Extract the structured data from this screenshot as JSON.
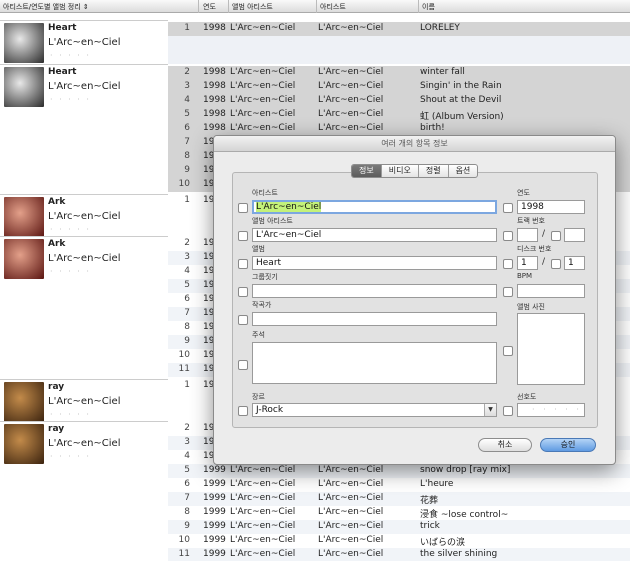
{
  "header": {
    "sort_col": "아티스트/연도별 앨범 정리",
    "year": "연도",
    "album_artist": "앨범 아티스트",
    "artist": "아티스트",
    "name": "이름"
  },
  "groups": [
    {
      "album": "Heart",
      "artist": "L'Arc~en~Ciel",
      "rating": "· · · · ·",
      "colors": [
        "#e8e8e8",
        "#2a2a2a"
      ]
    },
    {
      "album": "Heart",
      "artist": "L'Arc~en~Ciel",
      "rating": "· · · · ·",
      "colors": [
        "#e8e8e8",
        "#2a2a2a"
      ]
    },
    {
      "album": "Ark",
      "artist": "L'Arc~en~Ciel",
      "rating": "· · · · ·",
      "colors": [
        "#e3a08a",
        "#5a1410"
      ]
    },
    {
      "album": "Ark",
      "artist": "L'Arc~en~Ciel",
      "rating": "· · · · ·",
      "colors": [
        "#e3a08a",
        "#5a1410"
      ]
    },
    {
      "album": "ray",
      "artist": "L'Arc~en~Ciel",
      "rating": "· · · · ·",
      "colors": [
        "#c38b4a",
        "#3a220e"
      ]
    },
    {
      "album": "ray",
      "artist": "L'Arc~en~Ciel",
      "rating": "· · · · ·",
      "colors": [
        "#c38b4a",
        "#3a220e"
      ]
    }
  ],
  "tracks": [
    {
      "num": "1",
      "year": "1998",
      "album_artist": "L'Arc~en~Ciel",
      "artist": "L'Arc~en~Ciel",
      "title": "LORELEY"
    },
    {
      "num": "2",
      "year": "1998",
      "album_artist": "L'Arc~en~Ciel",
      "artist": "L'Arc~en~Ciel",
      "title": "winter fall"
    },
    {
      "num": "3",
      "year": "1998",
      "album_artist": "L'Arc~en~Ciel",
      "artist": "L'Arc~en~Ciel",
      "title": "Singin' in the Rain"
    },
    {
      "num": "4",
      "year": "1998",
      "album_artist": "L'Arc~en~Ciel",
      "artist": "L'Arc~en~Ciel",
      "title": "Shout at the Devil"
    },
    {
      "num": "5",
      "year": "1998",
      "album_artist": "L'Arc~en~Ciel",
      "artist": "L'Arc~en~Ciel",
      "title": "虹 (Album Version)"
    },
    {
      "num": "6",
      "year": "1998",
      "album_artist": "L'Arc~en~Ciel",
      "artist": "L'Arc~en~Ciel",
      "title": "birth!"
    },
    {
      "num": "7",
      "year": "19",
      "album_artist": "",
      "artist": "",
      "title": ""
    },
    {
      "num": "8",
      "year": "19",
      "album_artist": "",
      "artist": "",
      "title": ""
    },
    {
      "num": "9",
      "year": "19",
      "album_artist": "",
      "artist": "",
      "title": ""
    },
    {
      "num": "10",
      "year": "19",
      "album_artist": "",
      "artist": "",
      "title": ""
    },
    {
      "num": "1",
      "year": "19",
      "album_artist": "",
      "artist": "",
      "title": ""
    },
    {
      "num": "2",
      "year": "19",
      "album_artist": "",
      "artist": "",
      "title": ""
    },
    {
      "num": "3",
      "year": "19",
      "album_artist": "",
      "artist": "",
      "title": ""
    },
    {
      "num": "4",
      "year": "19",
      "album_artist": "",
      "artist": "",
      "title": ""
    },
    {
      "num": "5",
      "year": "19",
      "album_artist": "",
      "artist": "",
      "title": ""
    },
    {
      "num": "6",
      "year": "19",
      "album_artist": "",
      "artist": "",
      "title": ""
    },
    {
      "num": "7",
      "year": "19",
      "album_artist": "",
      "artist": "",
      "title": ""
    },
    {
      "num": "8",
      "year": "19",
      "album_artist": "",
      "artist": "",
      "title": ""
    },
    {
      "num": "9",
      "year": "19",
      "album_artist": "",
      "artist": "",
      "title": ""
    },
    {
      "num": "10",
      "year": "19",
      "album_artist": "",
      "artist": "",
      "title": ""
    },
    {
      "num": "11",
      "year": "19",
      "album_artist": "",
      "artist": "",
      "title": ""
    },
    {
      "num": "1",
      "year": "19",
      "album_artist": "",
      "artist": "",
      "title": ""
    },
    {
      "num": "2",
      "year": "19",
      "album_artist": "",
      "artist": "",
      "title": ""
    },
    {
      "num": "3",
      "year": "19",
      "album_artist": "",
      "artist": "",
      "title": ""
    },
    {
      "num": "4",
      "year": "19",
      "album_artist": "",
      "artist": "",
      "title": ""
    },
    {
      "num": "5",
      "year": "1999",
      "album_artist": "L'Arc~en~Ciel",
      "artist": "L'Arc~en~Ciel",
      "title": "snow drop [ray mix]"
    },
    {
      "num": "6",
      "year": "1999",
      "album_artist": "L'Arc~en~Ciel",
      "artist": "L'Arc~en~Ciel",
      "title": "L'heure"
    },
    {
      "num": "7",
      "year": "1999",
      "album_artist": "L'Arc~en~Ciel",
      "artist": "L'Arc~en~Ciel",
      "title": "花葬"
    },
    {
      "num": "8",
      "year": "1999",
      "album_artist": "L'Arc~en~Ciel",
      "artist": "L'Arc~en~Ciel",
      "title": "浸食 ~lose control~"
    },
    {
      "num": "9",
      "year": "1999",
      "album_artist": "L'Arc~en~Ciel",
      "artist": "L'Arc~en~Ciel",
      "title": "trick"
    },
    {
      "num": "10",
      "year": "1999",
      "album_artist": "L'Arc~en~Ciel",
      "artist": "L'Arc~en~Ciel",
      "title": "いばらの涙"
    },
    {
      "num": "11",
      "year": "1999",
      "album_artist": "L'Arc~en~Ciel",
      "artist": "L'Arc~en~Ciel",
      "title": "the silver shining"
    }
  ],
  "dialog": {
    "title": "여러 개의 항목 정보",
    "tabs": [
      "정보",
      "비디오",
      "정렬",
      "옵션"
    ],
    "labels": {
      "artist": "아티스트",
      "year": "연도",
      "album_artist": "앨범 아티스트",
      "track_number": "트랙 번호",
      "album": "앨범",
      "disc_number": "디스크 번호",
      "grouping": "그룹짓기",
      "bpm": "BPM",
      "composer": "작곡가",
      "album_art": "앨범 사진",
      "comments": "주석",
      "genre": "장르",
      "rating": "선호도"
    },
    "values": {
      "artist": "L'Arc~en~Ciel",
      "year": "1998",
      "album_artist": "L'Arc~en~Ciel",
      "track": "",
      "track_total": "",
      "album": "Heart",
      "disc": "1",
      "disc_total": "1",
      "grouping": "",
      "bpm": "",
      "composer": "",
      "comments": "",
      "genre": "J-Rock",
      "rating": "· · · · ·"
    },
    "slash": "/",
    "cancel": "취소",
    "ok": "승인"
  },
  "colors": {
    "selected_row": "#d4d4d4",
    "alt_row": "#f1f4f8",
    "focus_ring": "#7ca7e0",
    "highlight": "#c4f27a",
    "primary_button": "#5f9be2"
  }
}
